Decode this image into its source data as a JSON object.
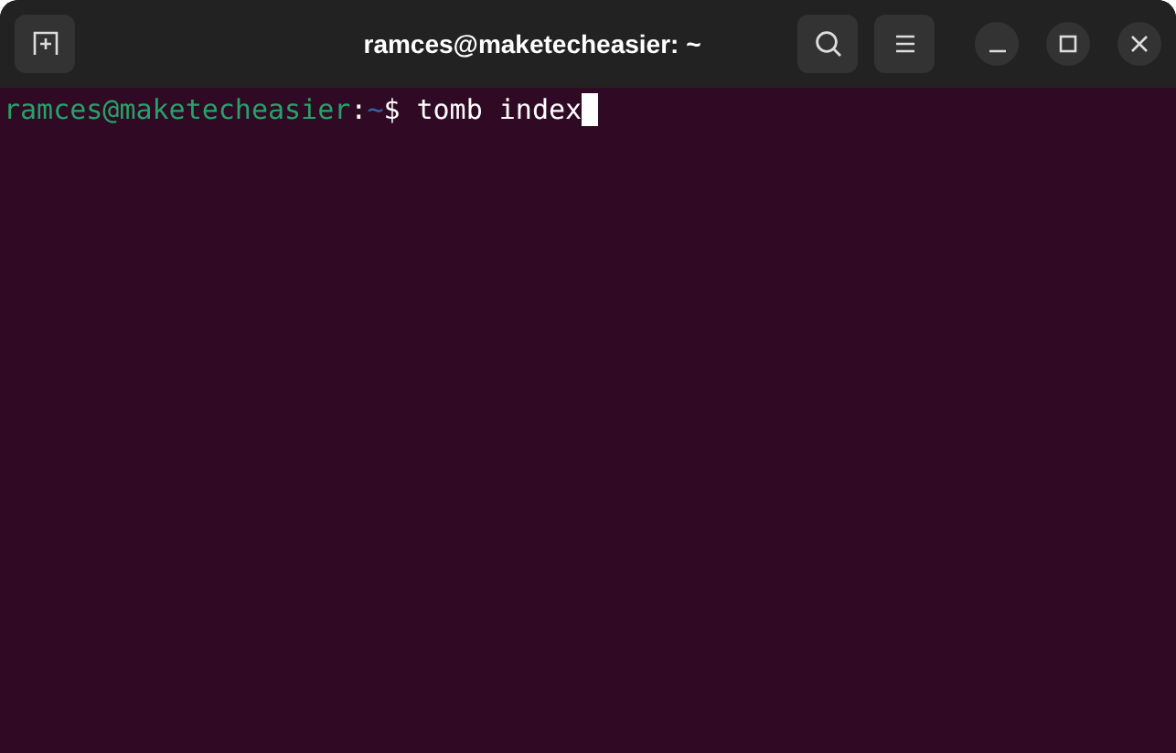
{
  "window": {
    "title": "ramces@maketecheasier: ~"
  },
  "terminal": {
    "user_host": "ramces@maketecheasier",
    "separator": ":",
    "path": "~",
    "prompt_symbol": "$",
    "command": "tomb index",
    "cursor_visible": true
  }
}
